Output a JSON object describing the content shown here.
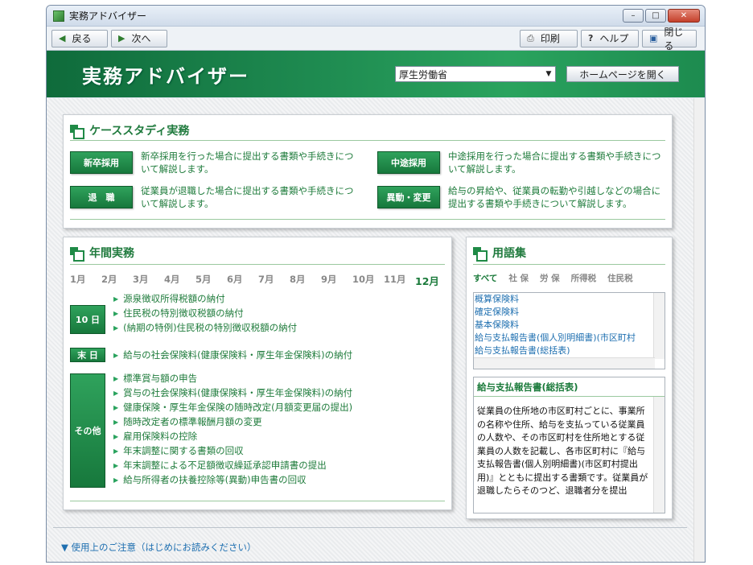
{
  "window": {
    "title": "実務アドバイザー",
    "min": "–",
    "max": "□",
    "close": "✕"
  },
  "toolbar": {
    "back": "戻る",
    "forward": "次へ",
    "print": "印刷",
    "help": "ヘルプ",
    "close": "閉じる"
  },
  "header": {
    "title": "実務アドバイザー",
    "ministry_selected": "厚生労働省",
    "homepage_button": "ホームページを開く"
  },
  "case_study": {
    "title": "ケーススタディ実務",
    "items": [
      {
        "label": "新卒採用",
        "desc": "新卒採用を行った場合に提出する書類や手続きについて解説します。"
      },
      {
        "label": "中途採用",
        "desc": "中途採用を行った場合に提出する書類や手続きについて解説します。"
      },
      {
        "label": "退　職",
        "desc": "従業員が退職した場合に提出する書類や手続きについて解説します。"
      },
      {
        "label": "異動・変更",
        "desc": "給与の昇給や、従業員の転勤や引越しなどの場合に提出する書類や手続きについて解説します。"
      }
    ]
  },
  "annual": {
    "title": "年間実務",
    "months": [
      "1月",
      "2月",
      "3月",
      "4月",
      "5月",
      "6月",
      "7月",
      "8月",
      "9月",
      "10月",
      "11月",
      "12月"
    ],
    "active_month": "12月",
    "groups": [
      {
        "badge": "10 日",
        "tasks": [
          "源泉徴収所得税額の納付",
          "住民税の特別徴収税額の納付",
          "(納期の特例)住民税の特別徴収税額の納付"
        ]
      },
      {
        "badge": "末 日",
        "tasks": [
          "給与の社会保険料(健康保険料・厚生年金保険料)の納付"
        ]
      },
      {
        "badge": "その他",
        "tasks": [
          "標準賞与額の申告",
          "賞与の社会保険料(健康保険料・厚生年金保険料)の納付",
          "健康保険・厚生年金保険の随時改定(月額変更届の提出)",
          "随時改定者の標準報酬月額の変更",
          "雇用保険料の控除",
          "年末調整に関する書類の回収",
          "年末調整による不足額徴収繰延承認申請書の提出",
          "給与所得者の扶養控除等(異動)申告書の回収"
        ]
      }
    ]
  },
  "glossary": {
    "title": "用語集",
    "tabs": [
      "すべて",
      "社 保",
      "労 保",
      "所得税",
      "住民税"
    ],
    "active_tab": "すべて",
    "terms": [
      "概算保険料",
      "確定保険料",
      "基本保険料",
      "給与支払報告書(個人別明細書)(市区町村",
      "給与支払報告書(総括表)"
    ],
    "definition_title": "給与支払報告書(総括表)",
    "definition_text": "従業員の住所地の市区町村ごとに、事業所の名称や住所、給与を支払っている従業員の人数や、その市区町村を住所地とする従業員の人数を記載し、各市区町村に『給与支払報告書(個人別明細書)(市区町村提出用)』とともに提出する書類です。従業員が退職したらそのつど、退職者分を提出"
  },
  "footer": {
    "notice": "▼ 使用上のご注意（はじめにお読みください）"
  }
}
